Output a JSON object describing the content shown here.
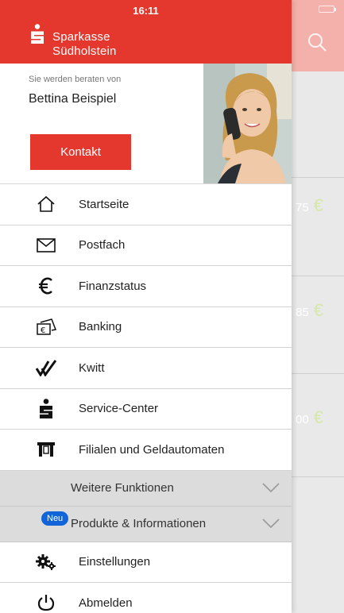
{
  "status": {
    "time": "16:11"
  },
  "brand": {
    "line1": "Sparkasse",
    "line2": "Südholstein"
  },
  "advisor": {
    "caption": "Sie werden beraten von",
    "name": "Bettina Beispiel",
    "contact_label": "Kontakt"
  },
  "menu": [
    {
      "label": "Startseite",
      "icon": "home-icon"
    },
    {
      "label": "Postfach",
      "icon": "mail-icon"
    },
    {
      "label": "Finanzstatus",
      "icon": "euro-icon"
    },
    {
      "label": "Banking",
      "icon": "banking-icon"
    },
    {
      "label": "Kwitt",
      "icon": "kwitt-icon"
    },
    {
      "label": "Service-Center",
      "icon": "sparkasse-icon"
    },
    {
      "label": "Filialen und Geldautomaten",
      "icon": "branch-icon"
    }
  ],
  "sections": [
    {
      "label": "Weitere Funktionen"
    },
    {
      "label": "Produkte & Informationen",
      "badge": "Neu"
    }
  ],
  "bottom_menu": [
    {
      "label": "Einstellungen",
      "icon": "settings-icon"
    },
    {
      "label": "Abmelden",
      "icon": "power-icon"
    }
  ],
  "background": {
    "amounts": [
      "75",
      "85",
      "00"
    ],
    "currency": "€"
  },
  "colors": {
    "brand_red": "#e4382e",
    "badge_blue": "#1265d8"
  }
}
